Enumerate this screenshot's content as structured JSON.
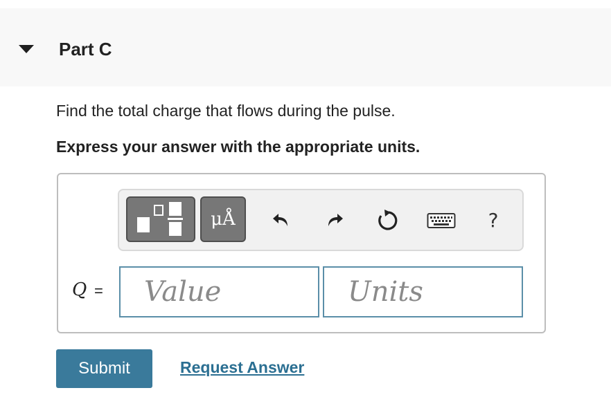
{
  "part": {
    "title": "Part C",
    "collapse_icon": "caret-down-icon"
  },
  "question": {
    "prompt": "Find the total charge that flows during the pulse.",
    "instruction": "Express your answer with the appropriate units."
  },
  "toolbar": {
    "templates_icon": "templates-icon",
    "units_label": "μÅ",
    "undo_icon": "undo-icon",
    "redo_icon": "redo-icon",
    "reset_icon": "reset-icon",
    "keyboard_icon": "keyboard-icon",
    "help_label": "?"
  },
  "answer": {
    "variable": "Q",
    "equals": "=",
    "value_placeholder": "Value",
    "units_placeholder": "Units"
  },
  "actions": {
    "submit_label": "Submit",
    "request_label": "Request Answer"
  },
  "colors": {
    "submit_bg": "#3a7a9b",
    "link": "#2b6f92",
    "field_border": "#5a8ea8",
    "tool_button_bg": "#777777"
  }
}
